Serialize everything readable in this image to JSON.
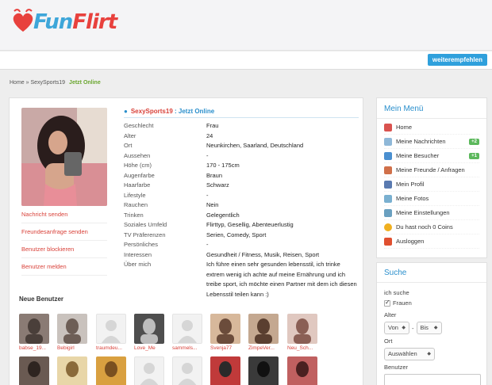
{
  "brand": {
    "part1": "Fun",
    "part2": "Flirt"
  },
  "navbar": {
    "recommend_label": "weiterempfehlen"
  },
  "breadcrumb": {
    "home": "Home",
    "sep": "»",
    "user": "SexySports19",
    "status": "Jetzt Online"
  },
  "profile": {
    "name": "SexySports19",
    "sep": " : ",
    "status": "Jetzt Online",
    "fields": [
      {
        "key": "Geschlecht",
        "value": "Frau"
      },
      {
        "key": "Alter",
        "value": "24"
      },
      {
        "key": "Ort",
        "value": "Neunkirchen, Saarland, Deutschland"
      },
      {
        "key": "Aussehen",
        "value": "-"
      },
      {
        "key": "Höhe (cm)",
        "value": "170 - 175cm"
      },
      {
        "key": "Augenfarbe",
        "value": "Braun"
      },
      {
        "key": "Haarfarbe",
        "value": "Schwarz"
      },
      {
        "key": "Lifestyle",
        "value": "-"
      },
      {
        "key": "Rauchen",
        "value": "Nein"
      },
      {
        "key": "Trinken",
        "value": "Gelegentlich"
      },
      {
        "key": "Soziales Umfeld",
        "value": "Flirttyp, Gesellig, Abenteuerlustig"
      },
      {
        "key": "TV Präferenzen",
        "value": "Serien, Comedy, Sport"
      },
      {
        "key": "Persönliches",
        "value": "-"
      },
      {
        "key": "Interessen",
        "value": "Gesundheit / Fitness, Musik, Reisen, Sport"
      },
      {
        "key": "Über mich",
        "value": "Ich führe einen sehr gesunden lebensstil, ich trinke extrem wenig ich achte auf meine Ernährung und ich treibe sport, ich möchte einen Partner mit dem ich diesen Lebensstil teilen kann :)"
      }
    ],
    "actions": [
      "Nachricht senden",
      "Freundesanfrage senden",
      "Benutzer blockieren",
      "Benutzer melden"
    ]
  },
  "new_users": {
    "title": "Neue Benutzer",
    "row1": [
      "babse_19...",
      "Bebigirl",
      "traumdeu...",
      "Love_Me",
      "sammels...",
      "Svenja77",
      "ZimpeVer...",
      "Neu_Sch..."
    ]
  },
  "menu": {
    "title": "Mein Menü",
    "items": [
      {
        "label": "Home",
        "icon": "home-icon",
        "badge": ""
      },
      {
        "label": "Meine Nachrichten",
        "icon": "mail-icon",
        "badge": "+2"
      },
      {
        "label": "Meine Besucher",
        "icon": "visitor-icon",
        "badge": "+1"
      },
      {
        "label": "Meine Freunde / Anfragen",
        "icon": "friends-icon",
        "badge": ""
      },
      {
        "label": "Mein Profil",
        "icon": "profile-icon",
        "badge": ""
      },
      {
        "label": "Meine Fotos",
        "icon": "photos-icon",
        "badge": ""
      },
      {
        "label": "Meine Einstellungen",
        "icon": "settings-icon",
        "badge": ""
      },
      {
        "label": "Du hast noch 0 Coins",
        "icon": "coin-icon",
        "badge": ""
      },
      {
        "label": "Ausloggen",
        "icon": "logout-icon",
        "badge": ""
      }
    ]
  },
  "search": {
    "title": "Suche",
    "i_search_label": "ich suche",
    "women_label": "Frauen",
    "age_label": "Alter",
    "from_value": "Von",
    "dash": "-",
    "to_value": "Bis",
    "location_label": "Ort",
    "location_value": "Auswählen",
    "user_label": "Benutzer"
  },
  "colors": {
    "accent_blue": "#2fa0dc",
    "accent_red": "#d9423a",
    "online_green": "#6aa62e",
    "badge_green": "#5cb85c"
  }
}
